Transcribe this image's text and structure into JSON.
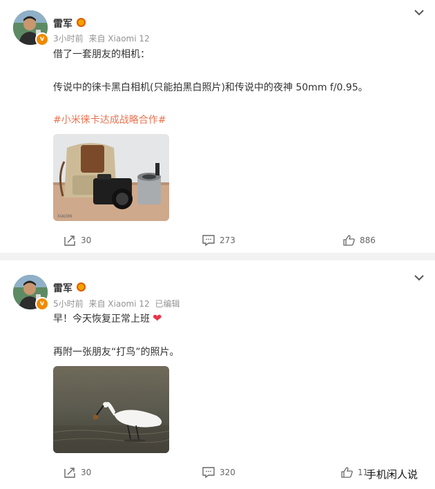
{
  "posts": [
    {
      "username": "雷军",
      "avatar_badge": "v",
      "time": "3小时前",
      "source": "来自 Xiaomi 12",
      "edited": "",
      "lines": [
        "借了一套朋友的相机：",
        "传说中的徕卡黑白相机(只能拍黑白照片)和传说中的夜神 50mm f/0.95。"
      ],
      "topic": "#小米徕卡达成战略合作#",
      "photo_icon": "camera-bag-photo",
      "photo_caption": "XIAOMI",
      "reposts": "30",
      "comments": "273",
      "likes": "886"
    },
    {
      "username": "雷军",
      "avatar_badge": "v",
      "time": "5小时前",
      "source": "来自 Xiaomi 12",
      "edited": "已编辑",
      "lines": [
        "早！今天恢复正常上班",
        "再附一张朋友“打鸟”的照片。"
      ],
      "topic": "",
      "photo_icon": "egret-photo",
      "reposts": "30",
      "comments": "320",
      "likes": "11"
    }
  ],
  "watermark": "手机闲人说",
  "colors": {
    "topic": "#eb7350",
    "heart": "#e6364b",
    "badge": "#f08a00",
    "meta": "#939393"
  }
}
